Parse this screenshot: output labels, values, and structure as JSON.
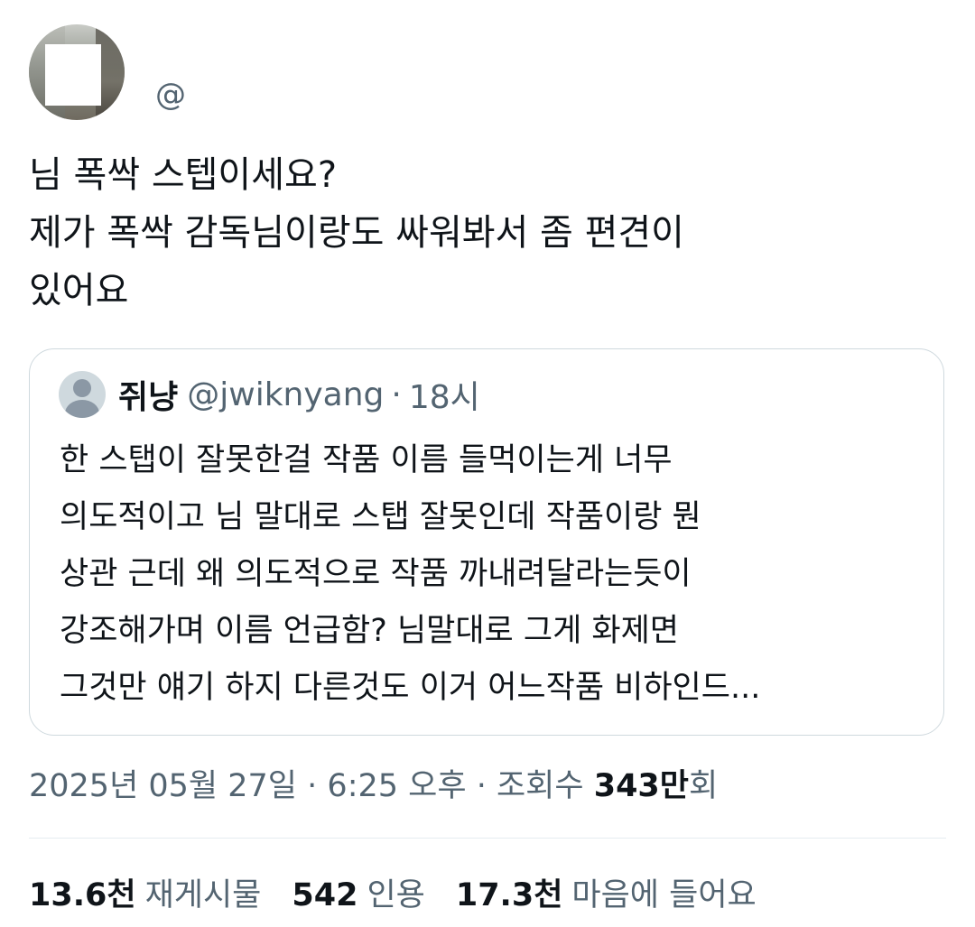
{
  "author": {
    "handle": "@"
  },
  "tweet": {
    "lines": [
      "님 폭싹 스텝이세요?",
      "제가 폭싹 감독님이랑도 싸워봐서 좀 편견이",
      "있어요"
    ]
  },
  "quoted": {
    "name": "쥐냥",
    "username": "@jwiknyang",
    "separator": "·",
    "time": "18시",
    "lines": [
      "한 스탭이 잘못한걸 작품 이름 들먹이는게 너무",
      "의도적이고 님 말대로 스탭 잘못인데 작품이랑 뭔",
      "상관 근데 왜 의도적으로 작품 까내려달라는듯이",
      "강조해가며 이름 언급함? 님말대로 그게 화제면",
      "그것만 얘기 하지 다른것도 이거 어느작품 비하인드..."
    ]
  },
  "meta": {
    "date": "2025년 05월 27일",
    "sep1": "·",
    "time": "6:25 오후",
    "sep2": "·",
    "views_label": "조회수",
    "views_number": "343만",
    "views_suffix": "회"
  },
  "stats": {
    "retweets_count": "13.6천",
    "retweets_label": "재게시물",
    "quotes_count": "542",
    "quotes_label": "인용",
    "likes_count": "17.3천",
    "likes_label": "마음에 들어요"
  },
  "colors": {
    "text": "#0f1419",
    "secondary": "#536471",
    "border": "#cfd9de"
  }
}
